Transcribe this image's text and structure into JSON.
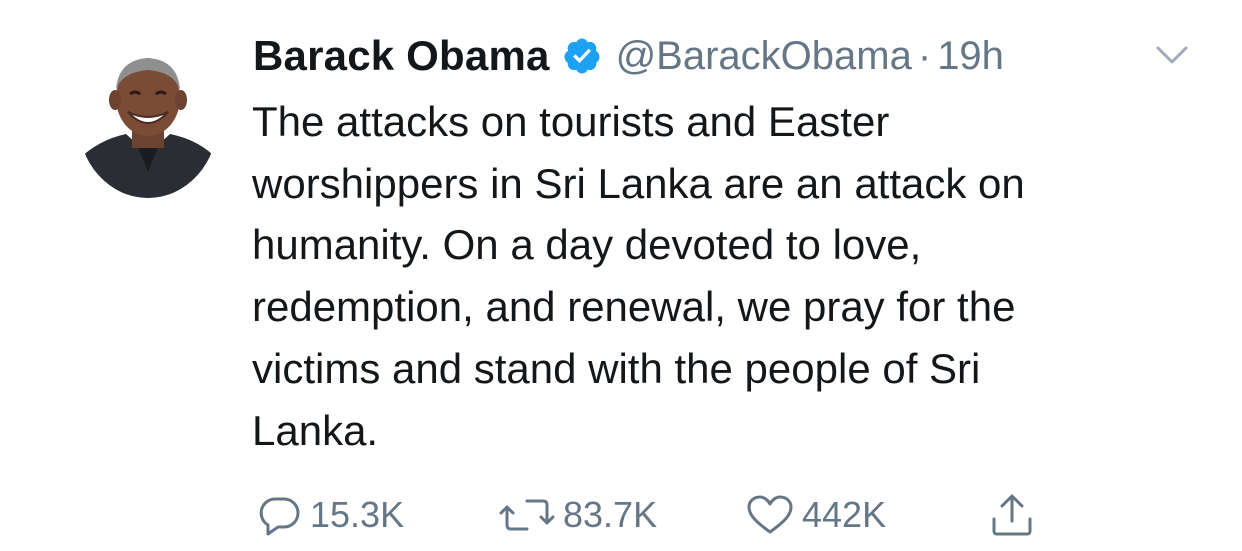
{
  "tweet": {
    "author_name": "Barack Obama",
    "handle": "@BarackObama",
    "separator": "·",
    "time": "19h",
    "text": "The attacks on tourists and Easter\nworshippers in Sri Lanka are an attack on\nhumanity. On a day devoted to love,\nredemption, and renewal, we pray for the\nvictims and stand with the people of Sri\nLanka.",
    "verified_icon": "verified-badge-icon",
    "avatar_icon": "avatar-photo",
    "caret_icon": "chevron-down-icon"
  },
  "actions": {
    "reply": {
      "icon": "reply-icon",
      "count": "15.3K"
    },
    "retweet": {
      "icon": "retweet-icon",
      "count": "83.7K"
    },
    "like": {
      "icon": "heart-icon",
      "count": "442K"
    },
    "share": {
      "icon": "share-icon"
    }
  },
  "colors": {
    "text": "#14171a",
    "secondary": "#657786",
    "verified_blue": "#1da1f2"
  }
}
